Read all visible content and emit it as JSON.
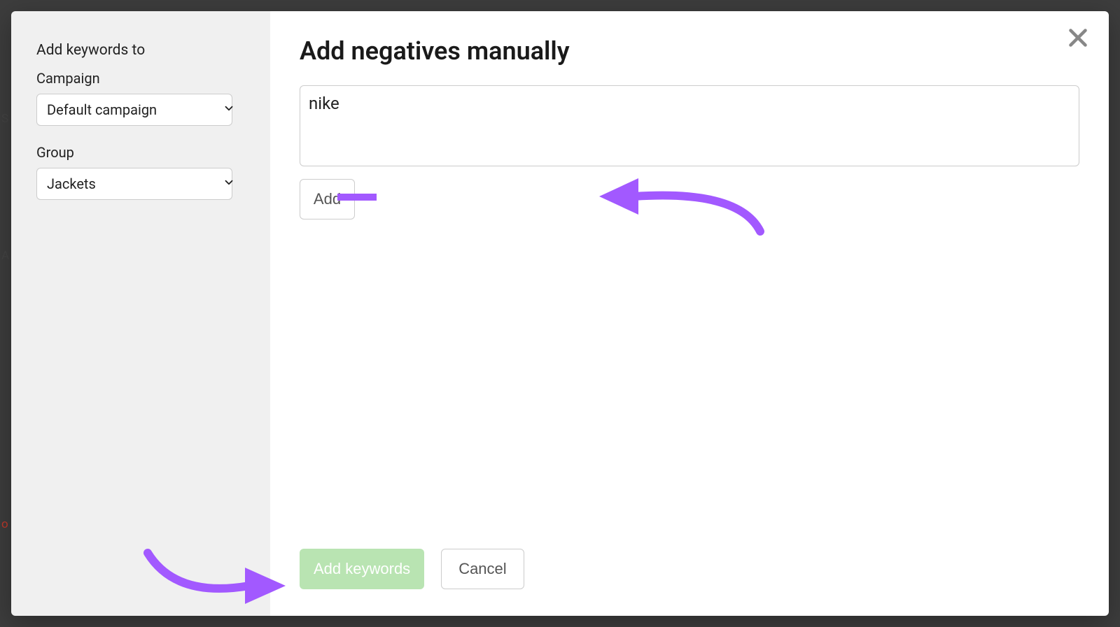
{
  "sidebar": {
    "title": "Add keywords to",
    "campaign_label": "Campaign",
    "campaign_value": "Default campaign",
    "group_label": "Group",
    "group_value": "Jackets"
  },
  "main": {
    "title": "Add negatives manually",
    "keyword_input_value": "nike",
    "add_label": "Add"
  },
  "footer": {
    "primary_label": "Add keywords",
    "cancel_label": "Cancel"
  },
  "annotation": {
    "color": "#a259ff"
  }
}
